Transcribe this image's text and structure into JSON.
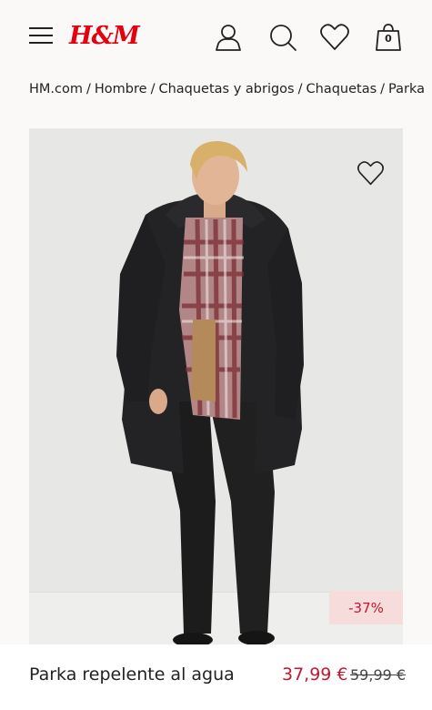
{
  "header": {
    "logo": "H&M",
    "brand_color": "#e50010",
    "icons": [
      "menu-icon",
      "account-icon",
      "search-icon",
      "favorites-icon",
      "shopping-bag-icon"
    ],
    "bag_count": "0"
  },
  "breadcrumb": {
    "items": [
      "HM.com",
      "Hombre",
      "Chaquetas y abrigos",
      "Chaquetas",
      "Parka"
    ],
    "separator": "/"
  },
  "product": {
    "name": "Parka repelente al agua",
    "price": "37,99 €",
    "original_price": "59,99 €",
    "discount": "-37%",
    "sale_color": "#c2182f",
    "discount_bg": "#f7dcdc"
  }
}
